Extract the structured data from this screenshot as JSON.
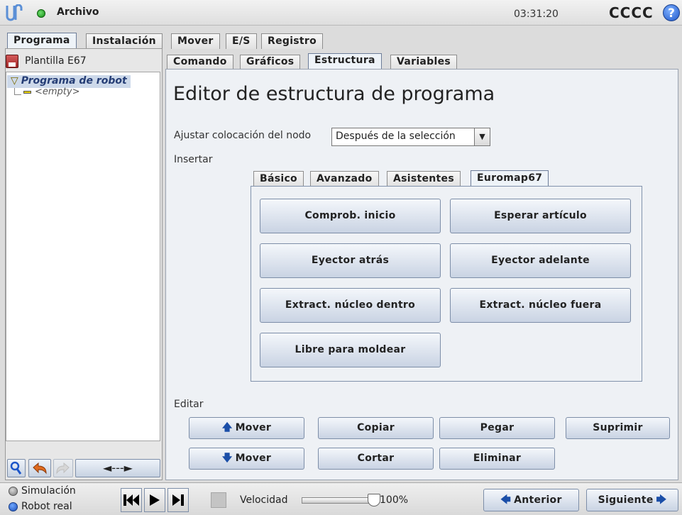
{
  "header": {
    "file_menu": "Archivo",
    "clock": "03:31:20",
    "robot_name": "CCCC",
    "help": "?"
  },
  "main_tabs": [
    {
      "label": "Programa",
      "active": true
    },
    {
      "label": "Instalación",
      "active": false
    },
    {
      "label": "Mover",
      "active": false
    },
    {
      "label": "E/S",
      "active": false
    },
    {
      "label": "Registro",
      "active": false
    }
  ],
  "sidebar": {
    "template_name": "Plantilla E67",
    "tree_root": "Programa de robot",
    "tree_empty": "<empty>",
    "tools": {
      "search": "search-icon",
      "undo": "undo-icon",
      "redo": "redo-icon",
      "arrows": "◄---►"
    }
  },
  "sub_tabs": [
    {
      "label": "Comando",
      "active": false
    },
    {
      "label": "Gráficos",
      "active": false
    },
    {
      "label": "Estructura",
      "active": true
    },
    {
      "label": "Variables",
      "active": false
    }
  ],
  "editor": {
    "title": "Editor de estructura de programa",
    "placement_label": "Ajustar colocación del nodo",
    "placement_value": "Después de la selección",
    "insert_label": "Insertar",
    "insert_tabs": [
      {
        "label": "Básico",
        "active": false
      },
      {
        "label": "Avanzado",
        "active": false
      },
      {
        "label": "Asistentes",
        "active": false
      },
      {
        "label": "Euromap67",
        "active": true
      }
    ],
    "insert_buttons": [
      "Comprob. inicio",
      "Esperar artículo",
      "Eyector atrás",
      "Eyector adelante",
      "Extract. núcleo dentro",
      "Extract. núcleo fuera",
      "Libre para moldear"
    ],
    "edit_label": "Editar",
    "edit_buttons": {
      "move_up": "Mover",
      "copy": "Copiar",
      "paste": "Pegar",
      "delete": "Suprimir",
      "move_down": "Mover",
      "cut": "Cortar",
      "remove": "Eliminar"
    }
  },
  "footer": {
    "simulation": "Simulación",
    "real_robot": "Robot real",
    "speed_label": "Velocidad",
    "speed_value": "100%",
    "speed_fraction": 1.0,
    "prev": "Anterior",
    "next": "Siguiente"
  },
  "colors": {
    "accent_blue": "#1a4ea8",
    "status_green": "#158a15",
    "selection": "#cdd9ea"
  }
}
